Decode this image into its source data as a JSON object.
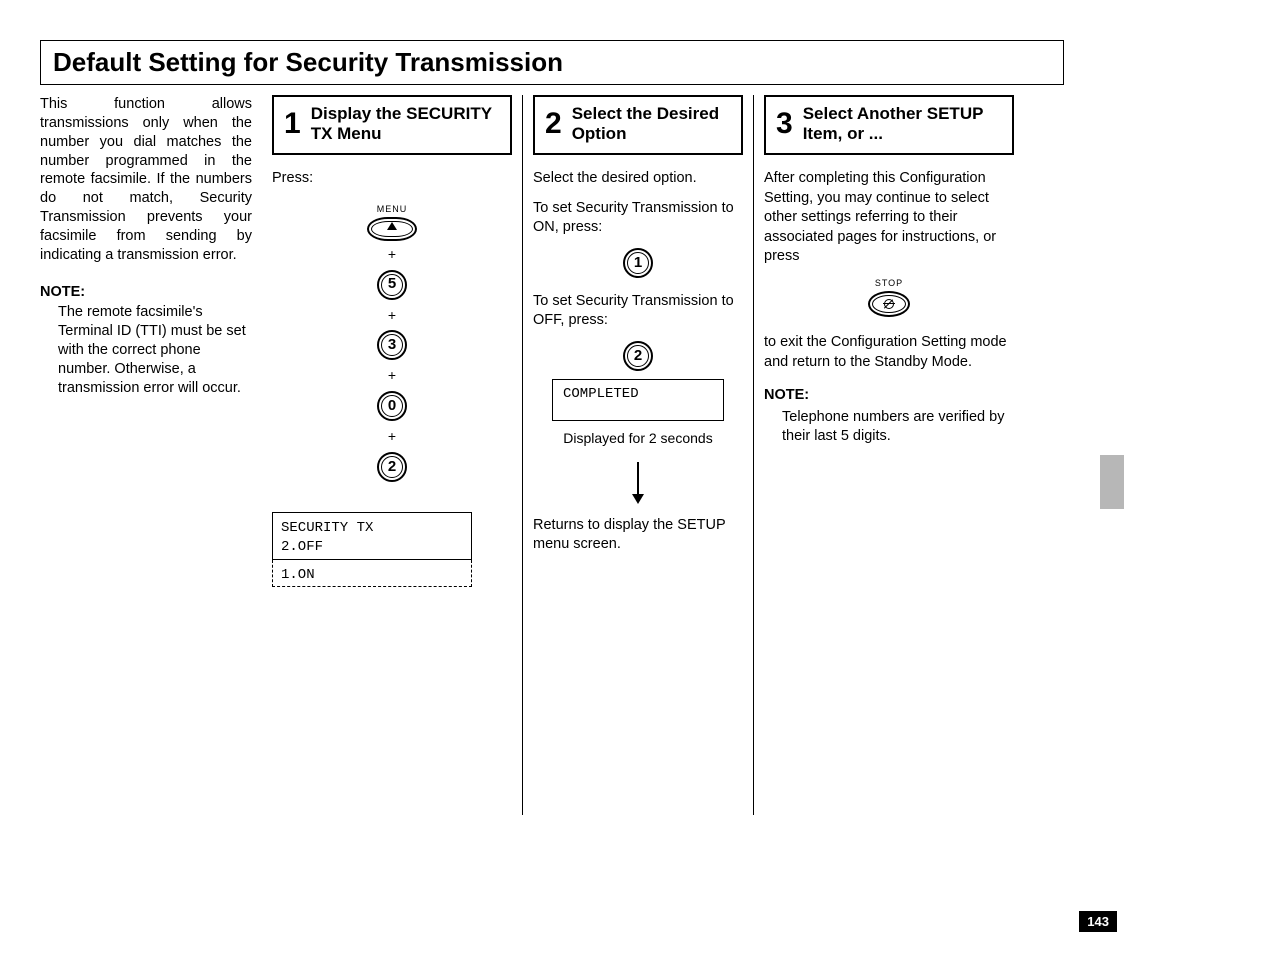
{
  "title": "Default Setting for Security Transmission",
  "intro": {
    "p1": "This function allows transmissions only when the number you dial matches the number programmed in the remote facsimile. If the numbers do not match, Security Transmission prevents your facsimile from sending by indicating a transmission error.",
    "note_head": "NOTE:",
    "note_body": "The remote facsimile's Terminal ID (TTI) must be set with the correct phone number. Otherwise, a transmission error will occur."
  },
  "steps": {
    "s1": {
      "num": "1",
      "title": "Display the SECURITY TX Menu",
      "press": "Press:",
      "menu_label": "MENU",
      "keys": [
        "5",
        "3",
        "0",
        "2"
      ],
      "plus": "+",
      "lcd_line1": "SECURITY TX",
      "lcd_line2": "2.OFF",
      "lcd_alt": "1.ON"
    },
    "s2": {
      "num": "2",
      "title": "Select the Desired Option",
      "p1": "Select the desired option.",
      "p2": "To set Security Transmission to ON, press:",
      "key_on": "1",
      "p3": "To set Security Transmission to OFF, press:",
      "key_off": "2",
      "lcd_completed": "COMPLETED",
      "caption": "Displayed for 2 seconds",
      "p4": "Returns to display the SETUP menu screen."
    },
    "s3": {
      "num": "3",
      "title": "Select Another SETUP Item, or ...",
      "p1": "After completing this Configuration Setting, you may continue to select other settings referring to their associated pages for instructions, or press",
      "stop_label": "STOP",
      "p2": "to exit the Configuration Setting mode and return to the Standby Mode.",
      "note_head": "NOTE:",
      "note_body": "Telephone numbers are verified by their last 5 digits."
    }
  },
  "page_number": "143"
}
